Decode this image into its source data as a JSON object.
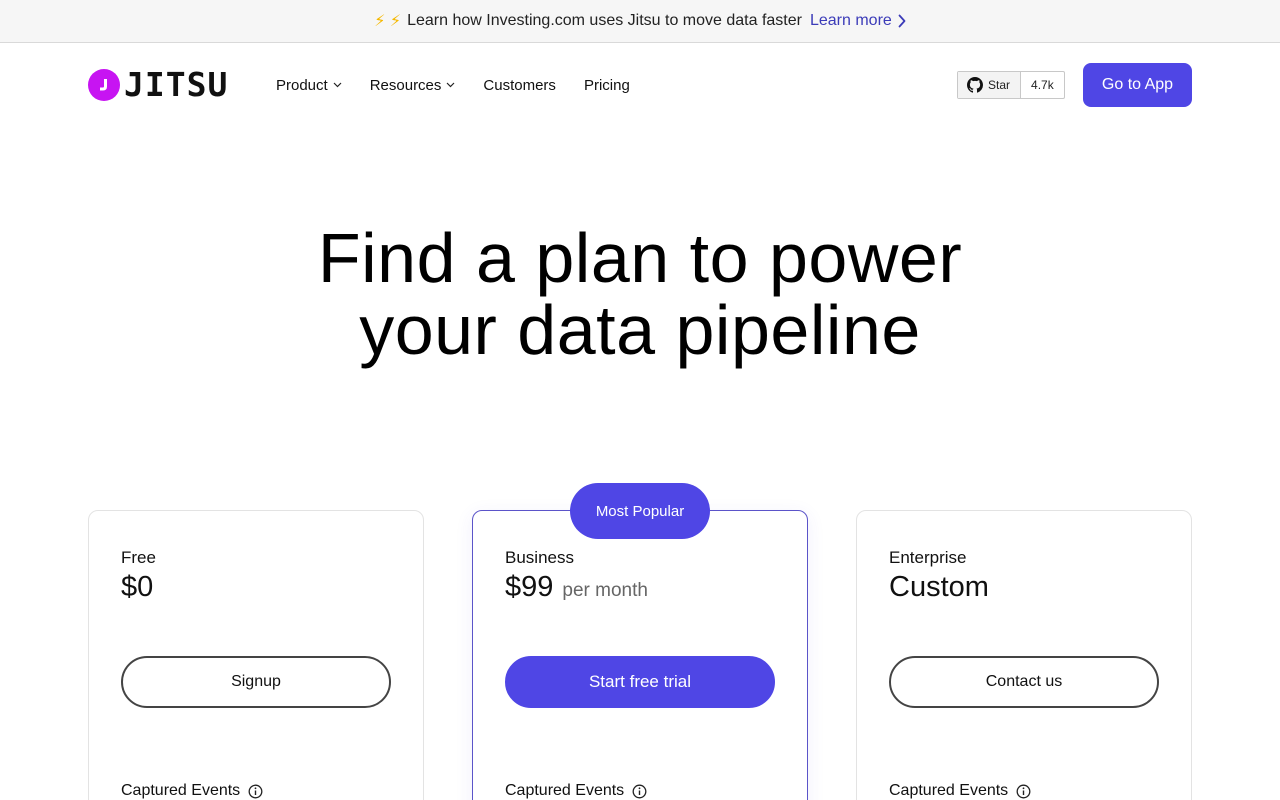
{
  "announcement": {
    "bolts": "⚡ ⚡",
    "text": "Learn how Investing.com uses Jitsu to move data faster",
    "link_label": "Learn more"
  },
  "nav": {
    "logo_text": "JITSU",
    "items": [
      {
        "label": "Product",
        "has_dropdown": true
      },
      {
        "label": "Resources",
        "has_dropdown": true
      },
      {
        "label": "Customers",
        "has_dropdown": false
      },
      {
        "label": "Pricing",
        "has_dropdown": false
      }
    ],
    "github": {
      "star_label": "Star",
      "count": "4.7k"
    },
    "cta_label": "Go to App"
  },
  "hero": {
    "line1": "Find a plan to power",
    "line2": "your data pipeline"
  },
  "plans": [
    {
      "name": "Free",
      "price": "$0",
      "period": "",
      "cta": "Signup",
      "feature": "Captured Events"
    },
    {
      "name": "Business",
      "price": "$99",
      "period": "per month",
      "cta": "Start free trial",
      "feature": "Captured Events",
      "badge": "Most Popular"
    },
    {
      "name": "Enterprise",
      "price": "Custom",
      "period": "",
      "cta": "Contact us",
      "feature": "Captured Events"
    }
  ],
  "colors": {
    "accent": "#4f46e5",
    "logo": "#c714f2",
    "bolt": "#f5b800"
  }
}
